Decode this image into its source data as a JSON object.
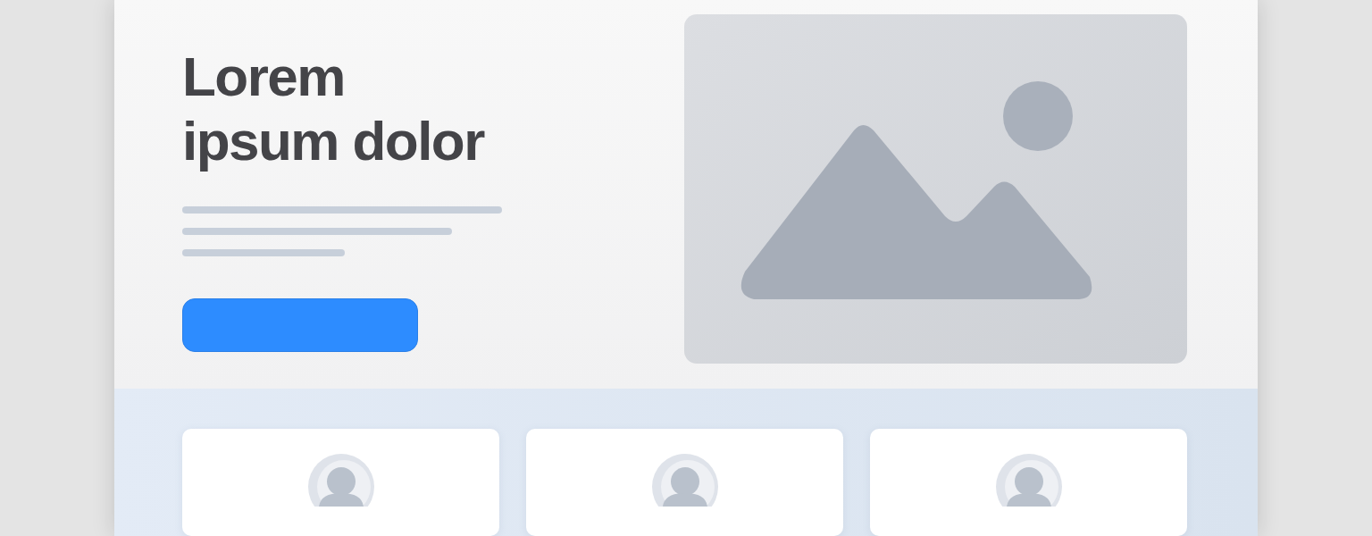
{
  "hero": {
    "title": "Lorem\nipsum dolor",
    "button": {
      "kind": "primary"
    },
    "image": {
      "kind": "placeholder"
    }
  },
  "cards": [
    {
      "kind": "profile"
    },
    {
      "kind": "profile"
    },
    {
      "kind": "profile"
    }
  ]
}
